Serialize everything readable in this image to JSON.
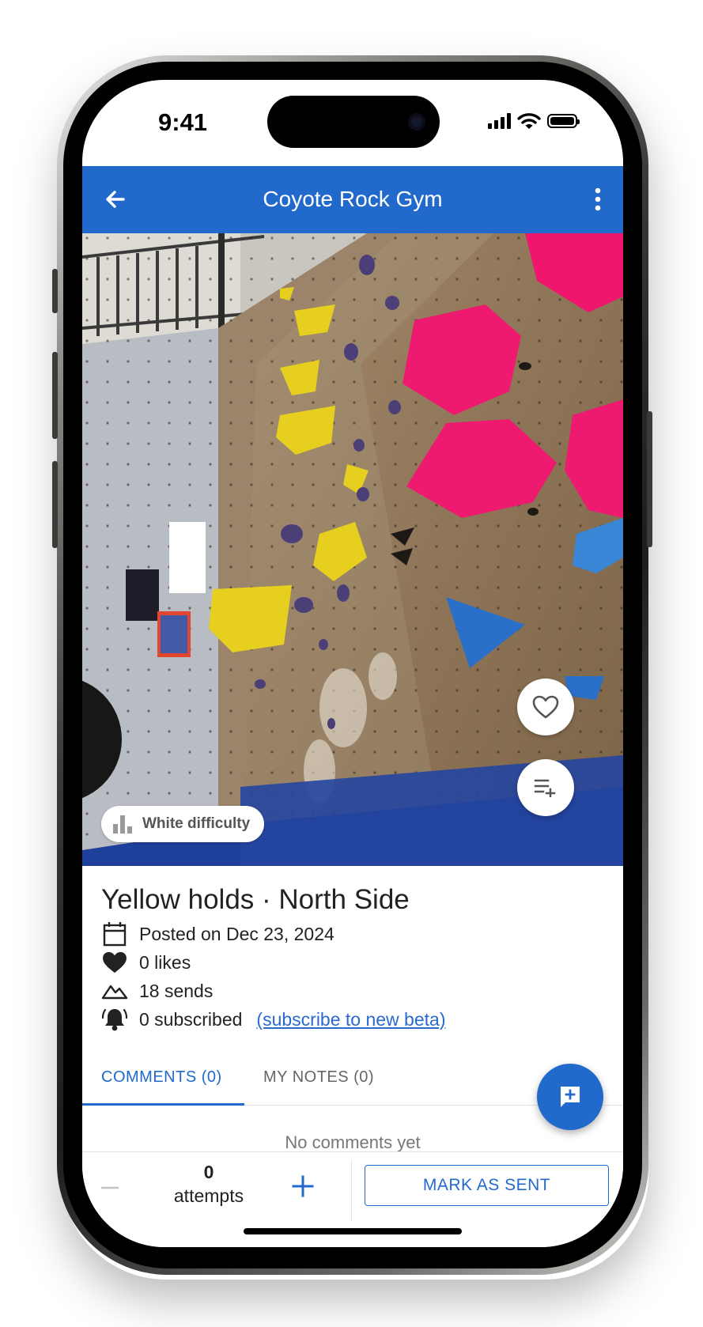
{
  "status_bar": {
    "time": "9:41"
  },
  "app_bar": {
    "title": "Coyote Rock Gym",
    "back_icon": "arrow-back-icon",
    "menu_icon": "more-vertical-icon"
  },
  "hero": {
    "difficulty_label": "White difficulty",
    "like_icon": "heart-outline-icon",
    "playlist_icon": "playlist-add-icon"
  },
  "route": {
    "title": "Yellow holds · North Side",
    "posted": "Posted on Dec 23, 2024",
    "likes": "0 likes",
    "sends": "18 sends",
    "subscribed": "0 subscribed",
    "subscribe_link": "(subscribe to new beta)"
  },
  "tabs": [
    {
      "label": "COMMENTS (0)",
      "active": true
    },
    {
      "label": "MY NOTES (0)",
      "active": false
    }
  ],
  "comments": {
    "empty_text": "No comments yet"
  },
  "bottom_bar": {
    "attempts_count": "0",
    "attempts_label": "attempts",
    "mark_sent_label": "MARK AS SENT"
  },
  "colors": {
    "primary": "#2269cc",
    "hold_yellow": "#e6cf1f",
    "hold_pink": "#f0166d",
    "hold_blue": "#2a70c8",
    "hold_purple": "#4b3f78"
  }
}
